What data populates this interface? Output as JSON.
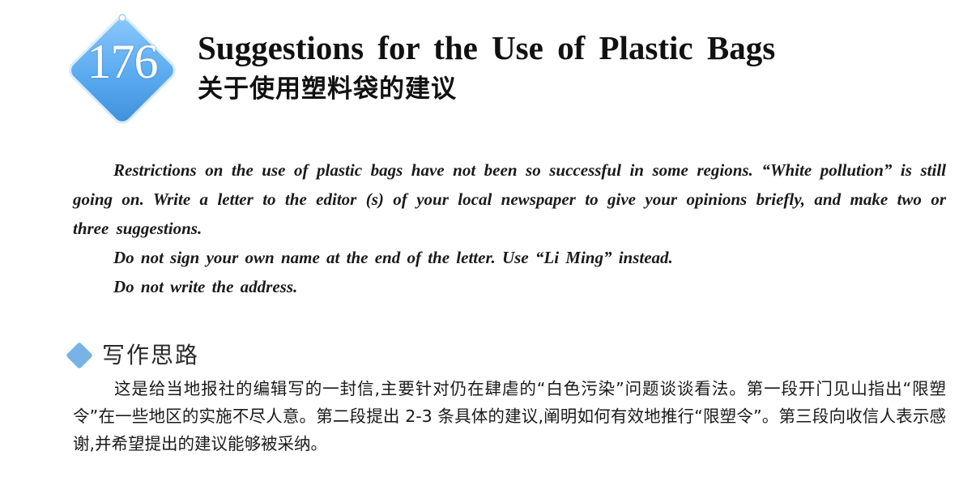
{
  "badge": {
    "number": "176",
    "color": "#5aaaf0"
  },
  "title": {
    "english": "Suggestions for the Use of Plastic Bags",
    "chinese": "关于使用塑料袋的建议"
  },
  "prompt": {
    "paragraph": "Restrictions on the use of plastic bags have not been so successful in some regions. “White pollution” is still going on. Write a letter to the editor (s) of your local newspaper to give your opinions briefly, and make two or three suggestions.",
    "note_signature": "Do not sign your own name at the end of the letter. Use “Li Ming” instead.",
    "note_address": "Do not write the address."
  },
  "section": {
    "icon": "diamond-icon",
    "icon_color": "#79b3e6",
    "heading": "写作思路",
    "body": "这是给当地报社的编辑写的一封信,主要针对仍在肆虐的“白色污染”问题谈谈看法。第一段开门见山指出“限塑令”在一些地区的实施不尽人意。第二段提出 2-3 条具体的建议,阐明如何有效地推行“限塑令”。第三段向收信人表示感谢,并希望提出的建议能够被采纳。"
  }
}
